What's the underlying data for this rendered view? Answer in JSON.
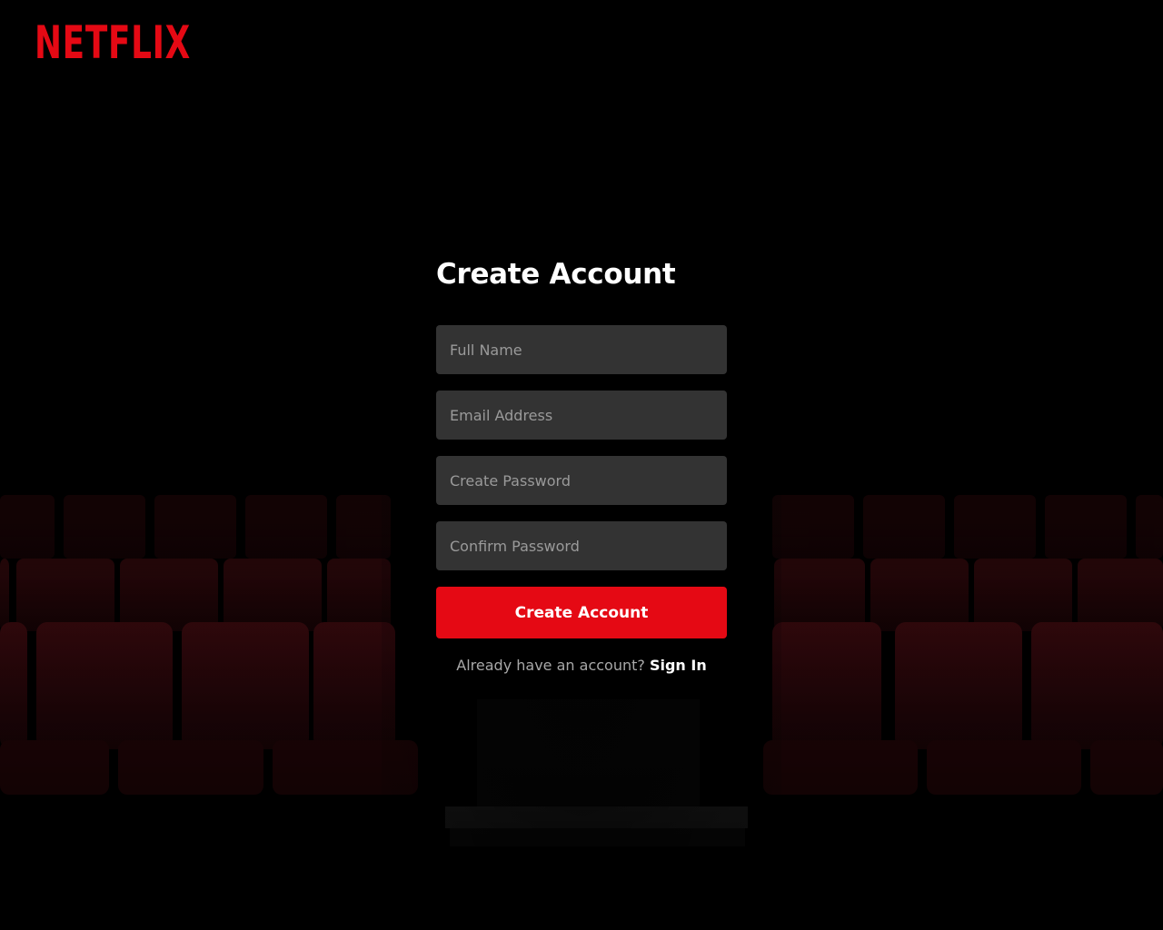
{
  "brand": {
    "logo_text": "NETFLIX",
    "logo_color": "#e50914"
  },
  "form": {
    "title": "Create Account",
    "fields": [
      {
        "name": "full-name",
        "placeholder": "Full Name",
        "value": ""
      },
      {
        "name": "email",
        "placeholder": "Email Address",
        "value": ""
      },
      {
        "name": "create-password",
        "placeholder": "Create Password",
        "value": ""
      },
      {
        "name": "confirm-password",
        "placeholder": "Confirm Password",
        "value": ""
      }
    ],
    "submit_label": "Create Account",
    "signin_prompt": "Already have an account?",
    "signin_link": "Sign In"
  },
  "colors": {
    "accent": "#e50914",
    "field_bg": "#333333",
    "background": "#000000"
  }
}
